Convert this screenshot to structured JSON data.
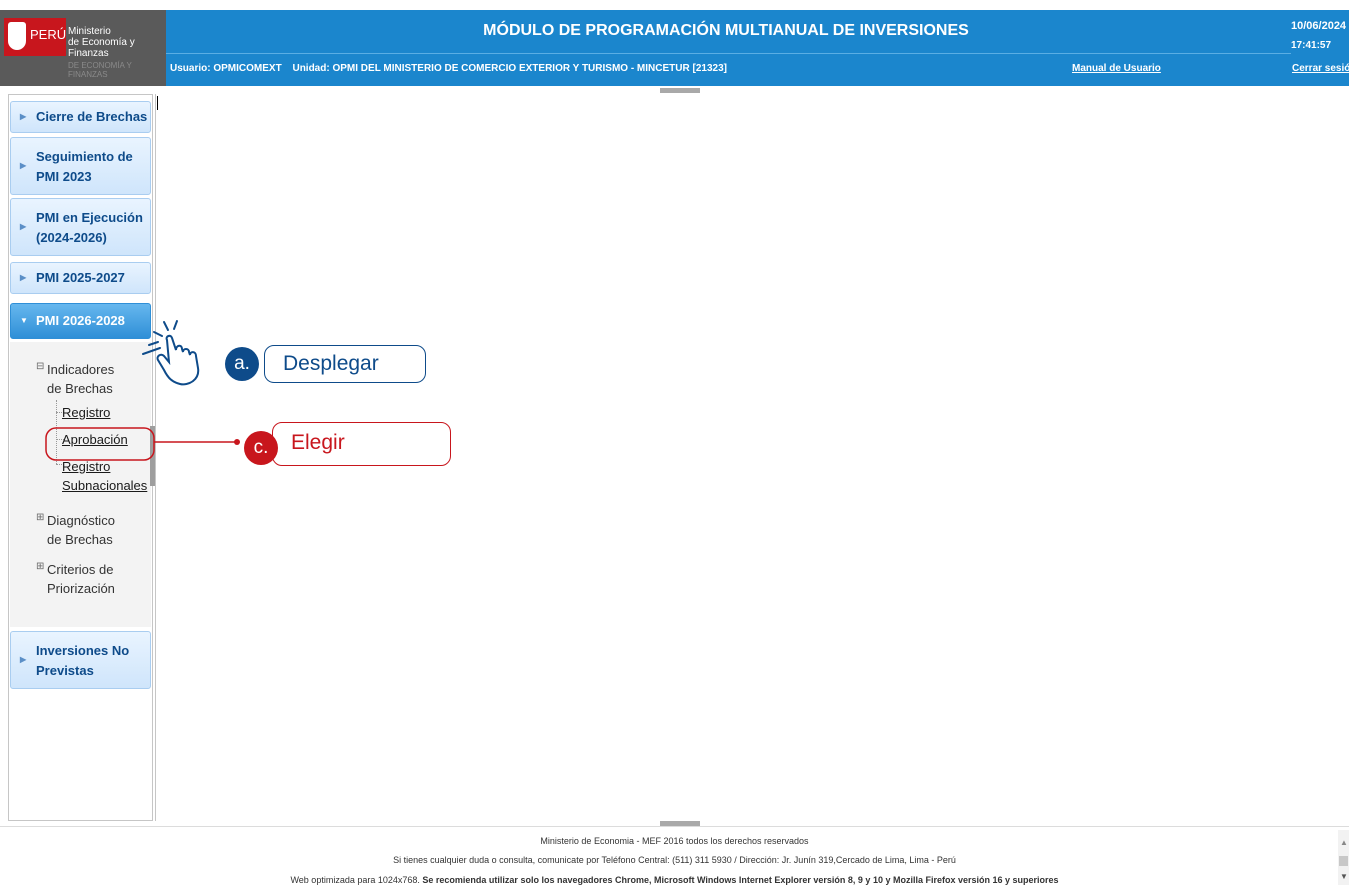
{
  "logo": {
    "peru": "PERÚ",
    "ministry_line1": "Ministerio",
    "ministry_line2": "de Economía y Finanzas",
    "subtext": "DE ECONOMÍA Y FINANZAS"
  },
  "header": {
    "title": "MÓDULO DE PROGRAMACIÓN MULTIANUAL DE INVERSIONES",
    "date": "10/06/2024",
    "time": "17:41:57",
    "user": "Usuario: OPMICOMEXT",
    "unit": "Unidad: OPMI DEL MINISTERIO DE COMERCIO EXTERIOR Y TURISMO - MINCETUR  [21323]",
    "manual_link": "Manual de Usuario",
    "logout_link": "Cerrar sesión",
    "bg_color": "#1b86cd"
  },
  "sidebar": {
    "items": [
      {
        "label_1": "Cierre de Brechas",
        "label_2": ""
      },
      {
        "label_1": "Seguimiento de",
        "label_2": "PMI 2023"
      },
      {
        "label_1": "PMI en Ejecución",
        "label_2": "(2024-2026)"
      },
      {
        "label_1": "PMI 2025-2027",
        "label_2": ""
      },
      {
        "label_1": "PMI 2026-2028",
        "label_2": "",
        "active": true
      },
      {
        "label_1": "Inversiones No",
        "label_2": "Previstas"
      }
    ],
    "tree": {
      "node1_line1": "Indicadores",
      "node1_line2": "de Brechas",
      "leaf_registro": "Registro",
      "leaf_aprobacion": "Aprobación",
      "leaf_sub_line1": "Registro",
      "leaf_sub_line2": "Subnacionales",
      "node2_line1": "Diagnóstico",
      "node2_line2": "de Brechas",
      "node3_line1": "Criterios de",
      "node3_line2": "Priorización",
      "expanded_symbol": "⊟",
      "collapsed_symbol": "⊞"
    }
  },
  "annotations": {
    "a_badge": "a.",
    "a_text": "Desplegar",
    "a_color": "#0e4b8a",
    "c_badge": "c.",
    "c_text": "Elegir",
    "c_color": "#c8161d"
  },
  "footer": {
    "line1": "Ministerio de Economia - MEF 2016 todos los derechos reservados",
    "line2": "Si tienes cualquier duda o consulta, comunicate por Teléfono Central: (511) 311 5930 / Dirección: Jr. Junín 319,Cercado de Lima, Lima - Perú",
    "line3_normal": "Web optimizada para 1024x768.",
    "line3_bold": "Se recomienda utilizar solo los navegadores Chrome, Microsoft Windows Internet Explorer versión 8, 9 y 10 y Mozilla Firefox versión 16 y superiores"
  }
}
